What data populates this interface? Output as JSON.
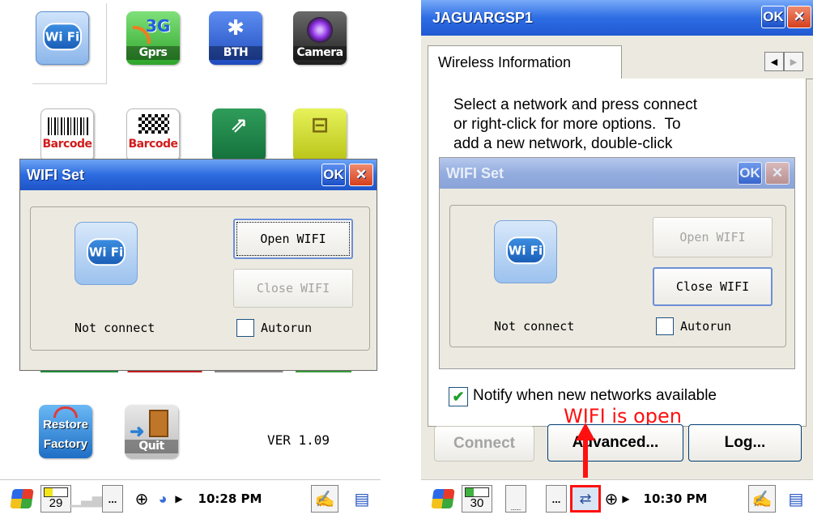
{
  "left": {
    "apps": [
      {
        "name": "wifi",
        "label": ""
      },
      {
        "name": "gprs",
        "label": "Gprs",
        "badge": "3G"
      },
      {
        "name": "bth",
        "label": "BTH"
      },
      {
        "name": "camera",
        "label": "Camera"
      },
      {
        "name": "barcode1",
        "label": "Barcode"
      },
      {
        "name": "barcode2",
        "label": "Barcode"
      },
      {
        "name": "usb",
        "label": ""
      },
      {
        "name": "serial",
        "label": ""
      },
      {
        "name": "restore",
        "label": "Restore Factory",
        "line1": "Restore",
        "line2": "Factory"
      },
      {
        "name": "quit",
        "label": "Quit"
      }
    ],
    "wifi_logo_text": "Wi Fi",
    "version": "VER 1.09",
    "dialog": {
      "title": "WIFI Set",
      "ok_label": "OK",
      "close_label": "✕",
      "open_button": "Open WIFI",
      "close_button": "Close WIFI",
      "status": "Not connect",
      "autorun_label": "Autorun",
      "autorun_checked": false
    },
    "taskbar": {
      "battery": "29",
      "dots": "...",
      "clock": "10:28 PM"
    }
  },
  "right": {
    "window_title": "JAGUARGSP1",
    "ok_label": "OK",
    "close_label": "✕",
    "tab_label": "Wireless Information",
    "info_line1": "Select a network and press connect",
    "info_line2": "or right-click for more options.  To",
    "info_line3": "add a new network, double-click",
    "notify_label": "Notify when new networks available",
    "notify_checked": true,
    "connect_button": "Connect",
    "advanced_button": "Advanced...",
    "log_button": "Log...",
    "annotation": "WIFI is open",
    "dialog": {
      "title": "WIFI Set",
      "ok_label": "OK",
      "close_label": "✕",
      "open_button": "Open WIFI",
      "close_button": "Close WIFI",
      "status": "Not connect",
      "autorun_label": "Autorun",
      "autorun_checked": false
    },
    "taskbar": {
      "battery": "30",
      "dots": "...",
      "clock": "10:30 PM"
    }
  },
  "colors": {
    "title_blue": "#2c6be0",
    "close_red": "#d6401c",
    "annotation_red": "#ff1010"
  }
}
